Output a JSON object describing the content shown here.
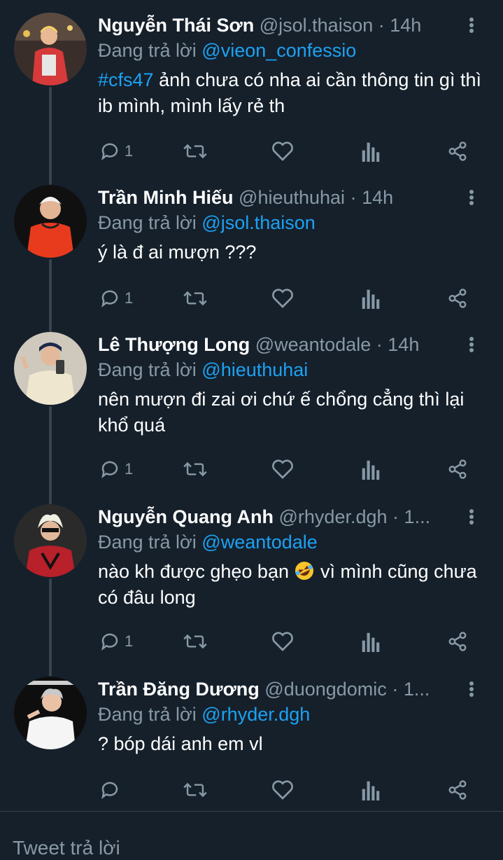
{
  "tweets": [
    {
      "name": "Nguyễn Thái Sơn",
      "handle": "@jsol.thaison",
      "time": "14h",
      "reply_prefix": "Đang trả lời",
      "reply_mention": "@vieon_confessio",
      "hashtag": "#cfs47",
      "text": " ảnh chưa có nha ai cần thông tin gì thì ib mình, mình lấy rẻ th",
      "reply_count": "1"
    },
    {
      "name": "Trần Minh Hiếu",
      "handle": "@hieuthuhai",
      "time": "14h",
      "reply_prefix": "Đang trả lời",
      "reply_mention": "@jsol.thaison",
      "text": "ý là đ ai mượn ???",
      "reply_count": "1"
    },
    {
      "name": "Lê Thượng Long",
      "handle": "@weantodale",
      "time": "14h",
      "reply_prefix": "Đang trả lời",
      "reply_mention": "@hieuthuhai",
      "text": "nên mượn đi zai ơi chứ ế chổng cẳng thì lại khổ quá",
      "reply_count": "1"
    },
    {
      "name": "Nguyễn Quang Anh",
      "handle": "@rhyder.dgh",
      "time": "1...",
      "reply_prefix": "Đang trả lời",
      "reply_mention": "@weantodale",
      "text_before_emoji": "nào kh được ghẹo bạn ",
      "emoji": "rolling-on-floor-laughing",
      "text_after_emoji": " vì mình cũng chưa có đâu long",
      "reply_count": "1"
    },
    {
      "name": "Trần Đăng Dương",
      "handle": "@duongdomic",
      "time": "1...",
      "reply_prefix": "Đang trả lời",
      "reply_mention": "@rhyder.dgh",
      "text": "? bóp dái anh em vl",
      "reply_count": ""
    }
  ],
  "separator": "·",
  "compose": {
    "placeholder": "Tweet trả lời"
  },
  "icons": [
    "reply-icon",
    "retweet-icon",
    "like-icon",
    "analytics-icon",
    "share-icon",
    "more-icon"
  ],
  "colors": {
    "background": "#15202b",
    "accent": "#1da1f2",
    "secondary_text": "#8899a6",
    "thread_line": "#38444d"
  }
}
